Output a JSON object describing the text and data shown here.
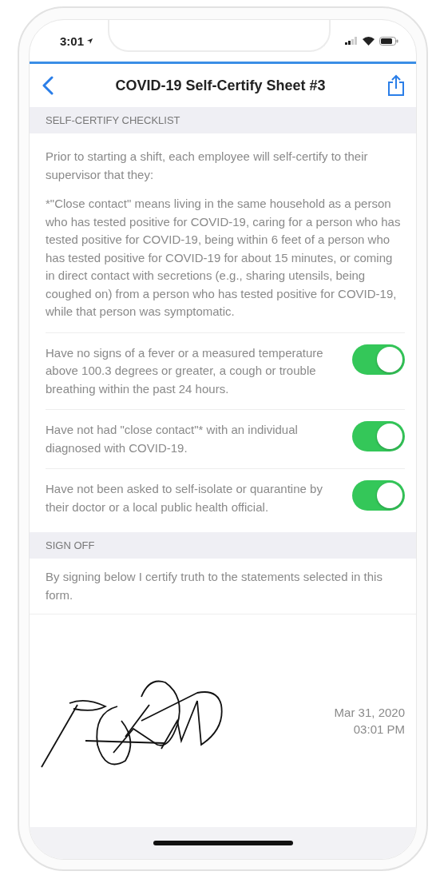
{
  "status_bar": {
    "time": "3:01"
  },
  "nav": {
    "title": "COVID-19 Self-Certify Sheet #3"
  },
  "checklist": {
    "header": "SELF-CERTIFY CHECKLIST",
    "intro": "Prior to starting a shift, each employee will self-certify to their supervisor that they:",
    "footnote": "*\"Close contact\" means living in the same household as a person who has tested positive for COVID-19, caring for a person who has tested positive for COVID-19, being within 6 feet of a person who has tested positive for COVID-19 for about 15 minutes, or coming in direct contact with secretions (e.g., sharing utensils, being coughed on) from a person who has tested positive for COVID-19, while that person was symptomatic.",
    "items": [
      {
        "text": "Have no signs of a fever or a measured temperature above 100.3 degrees or greater, a cough or trouble breathing within the past 24 hours.",
        "on": true
      },
      {
        "text": "Have not had \"close contact\"* with an individual diagnosed with COVID-19.",
        "on": true
      },
      {
        "text": "Have not been asked to self-isolate or quarantine by their doctor or a local public health official.",
        "on": true
      }
    ]
  },
  "sign_off": {
    "header": "SIGN OFF",
    "statement": "By signing below I certify truth to the statements selected in this form.",
    "date": "Mar 31, 2020",
    "time": "03:01 PM"
  }
}
